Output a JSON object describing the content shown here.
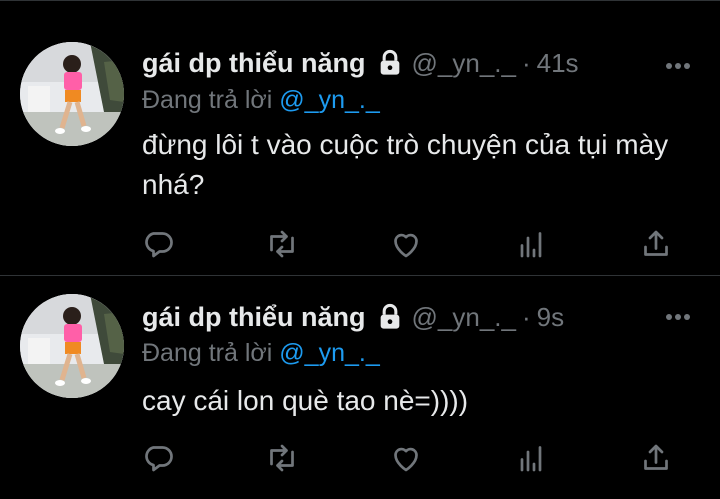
{
  "tweets": [
    {
      "display_name": "gái dp thiểu năng",
      "handle": "@_yn_._",
      "separator": "·",
      "time": "41s",
      "reply_prefix": "Đang trả lời",
      "reply_to": "@_yn_._",
      "text": "đừng lôi t vào cuộc trò chuyện của tụi mày nhá?"
    },
    {
      "display_name": "gái dp thiểu năng",
      "handle": "@_yn_._",
      "separator": "·",
      "time": "9s",
      "reply_prefix": "Đang trả lời",
      "reply_to": "@_yn_._",
      "text": "cay cái lon què tao nè=))))"
    }
  ],
  "icons": [
    "lock-icon",
    "more-icon",
    "reply-icon",
    "retweet-icon",
    "like-icon",
    "views-icon",
    "share-icon"
  ],
  "colors": {
    "background": "#000000",
    "text": "#e7e9ea",
    "muted": "#71767b",
    "accent": "#1d9bf0",
    "divider": "#2f3336"
  }
}
